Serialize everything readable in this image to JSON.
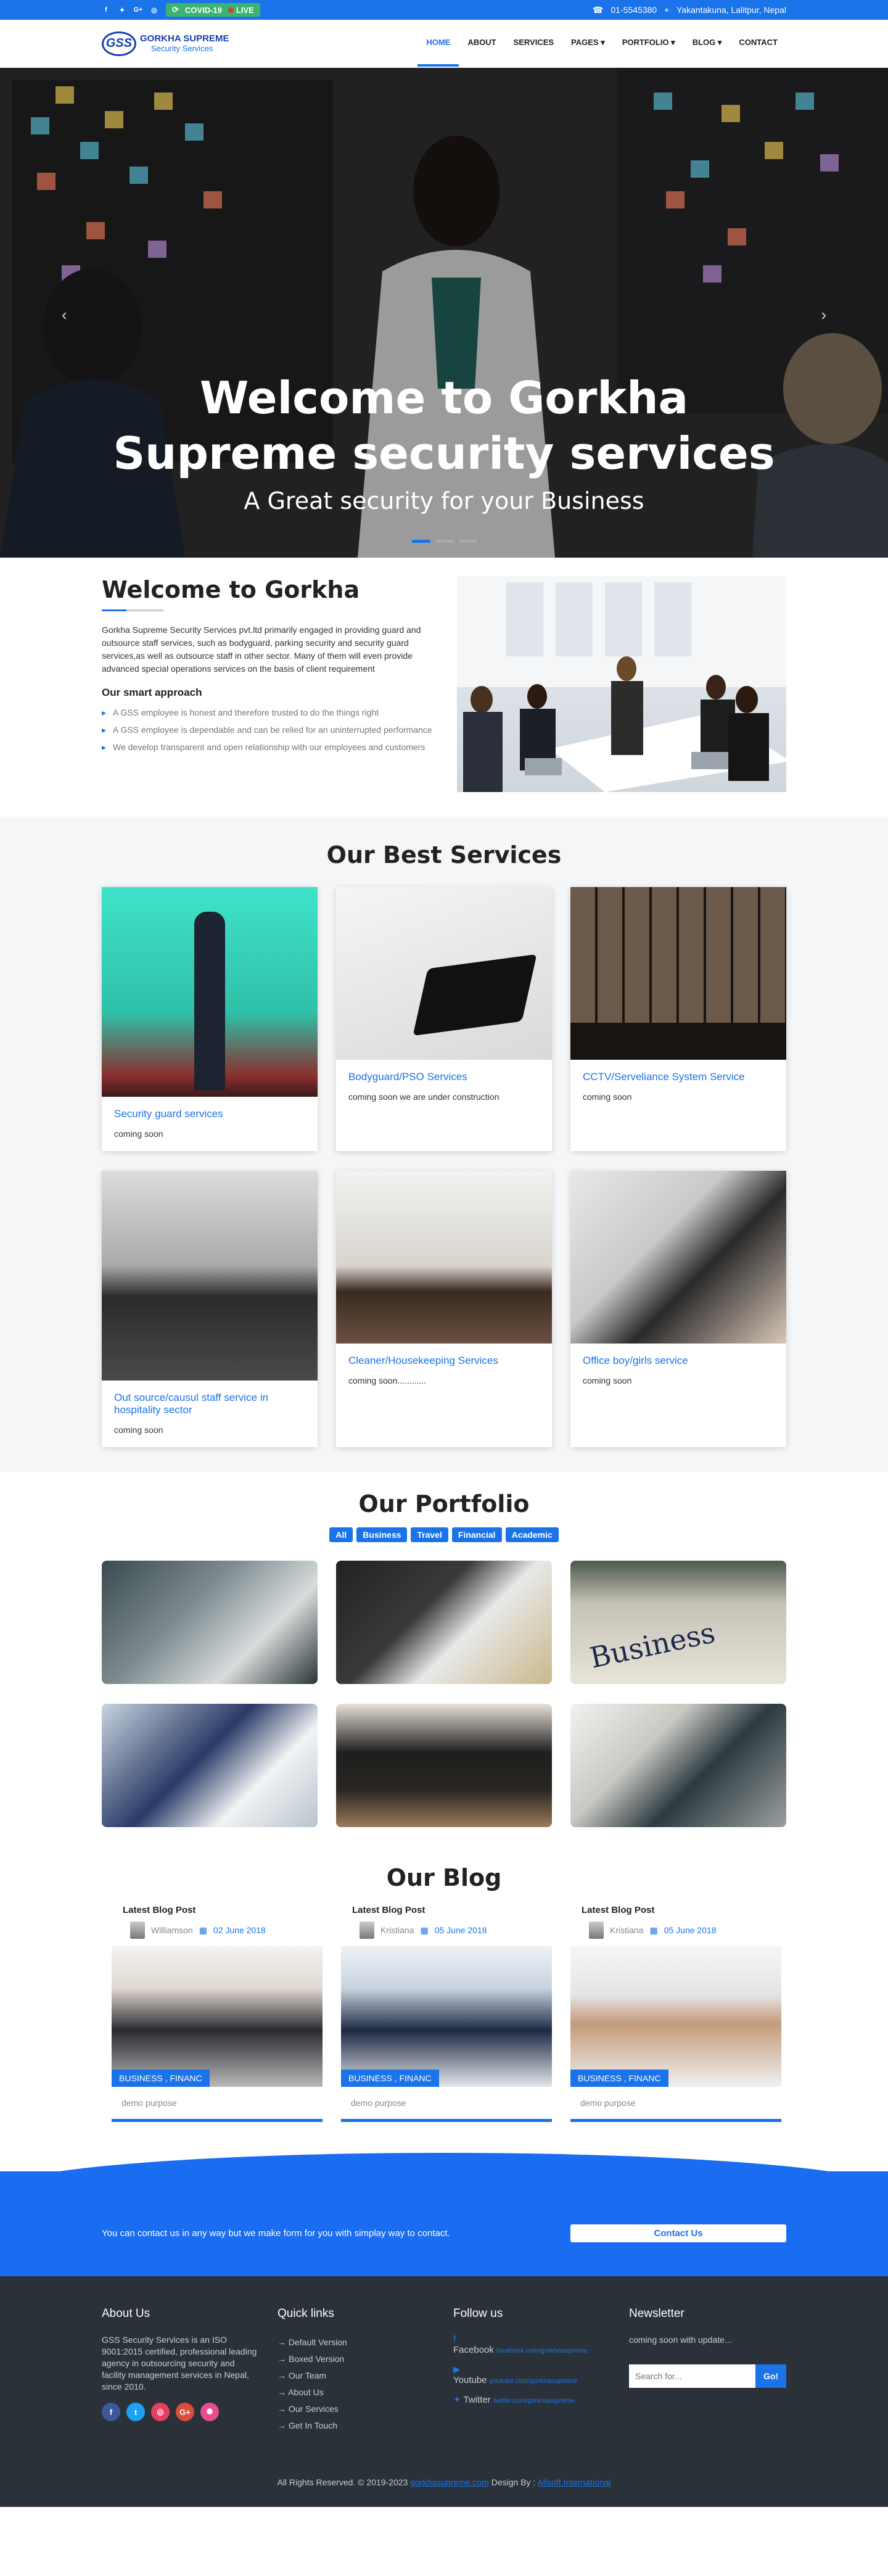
{
  "topbar": {
    "covid": "COVID-19",
    "live": "LIVE",
    "phone": "01-5545380",
    "address": "Yakantakuna, Lalitpur, Nepal"
  },
  "logo": {
    "mark": "GSS",
    "name": "GORKHA SUPREME",
    "tagline": "Security Services"
  },
  "nav": [
    "HOME",
    "ABOUT",
    "SERVICES",
    "PAGES ▾",
    "PORTFOLIO ▾",
    "BLOG ▾",
    "CONTACT"
  ],
  "hero": {
    "title_line1": "Welcome to Gorkha",
    "title_line2": "Supreme security services",
    "subtitle": "A Great security for your Business"
  },
  "welcome": {
    "title": "Welcome to Gorkha",
    "intro": "Gorkha Supreme Security Services pvt.ltd primarily engaged in providing guard and outsource staff services, such as bodyguard, parking security and security guard services,as well as outsource staff in other sector. Many of them will even provide advanced special operations services on the basis of client requirement",
    "approach_title": "Our smart approach",
    "points": [
      "A GSS employee is honest and therefore trusted to do the things right",
      "A GSS employee is dependable and can be relied for an uninterrupted performance",
      "We develop transparent and open relationship with our employees and customers"
    ]
  },
  "services": {
    "title": "Our Best Services",
    "items": [
      {
        "title": "Security guard services",
        "text": "coming soon"
      },
      {
        "title": "Bodyguard/PSO Services",
        "text": "coming soon we are under construction"
      },
      {
        "title": "CCTV/Serveliance System Service",
        "text": "coming soon"
      },
      {
        "title": "Out source/causul staff service in hospitality sector",
        "text": "coming soon"
      },
      {
        "title": "Cleaner/Housekeeping Services",
        "text": "coming soon............"
      },
      {
        "title": "Office boy/girls service",
        "text": "coming soon"
      }
    ]
  },
  "portfolio": {
    "title": "Our Portfolio",
    "filters": [
      "All",
      "Business",
      "Travel",
      "Financial",
      "Academic"
    ],
    "business_word": "Business"
  },
  "blog": {
    "title": "Our Blog",
    "posts": [
      {
        "label": "Latest Blog Post",
        "author": "Williamson",
        "date": "02 June 2018",
        "tag": "BUSINESS , FINANC",
        "text": "demo purpose"
      },
      {
        "label": "Latest Blog Post",
        "author": "Kristiana",
        "date": "05 June 2018",
        "tag": "BUSINESS , FINANC",
        "text": "demo purpose"
      },
      {
        "label": "Latest Blog Post",
        "author": "Kristiana",
        "date": "05 June 2018",
        "tag": "BUSINESS , FINANC",
        "text": "demo purpose"
      }
    ]
  },
  "contact": {
    "text": "You can contact us in any way but we make form for you with simplay way to contact.",
    "button": "Contact Us"
  },
  "footer": {
    "about_title": "About Us",
    "about_text": "GSS Security Services is an ISO 9001:2015 certified, professional leading agency in outsourcing security and facility management services in Nepal, since 2010.",
    "links_title": "Quick links",
    "links": [
      "→ Default Version",
      "→ Boxed Version",
      "→ Our Team",
      "→ About Us",
      "→ Our Services",
      "→ Get In Touch"
    ],
    "follow_title": "Follow us",
    "follow": [
      {
        "name": "Facebook",
        "url": "facebook.com/gorkhasupreme"
      },
      {
        "name": "Youtube",
        "url": "youtube.com/gorkhasupreme"
      },
      {
        "name": "Twitter",
        "url": "twitter.com/gorkhasupreme"
      }
    ],
    "newsletter_title": "Newsletter",
    "newsletter_text": "coming soon with update...",
    "search_placeholder": "Search for...",
    "go": "Go!",
    "copyright": "All Rights Reserved. © 2019-2023",
    "site": "gorkhasupreme.com",
    "design_by": "Design By :",
    "designer": "Allsoft International"
  }
}
